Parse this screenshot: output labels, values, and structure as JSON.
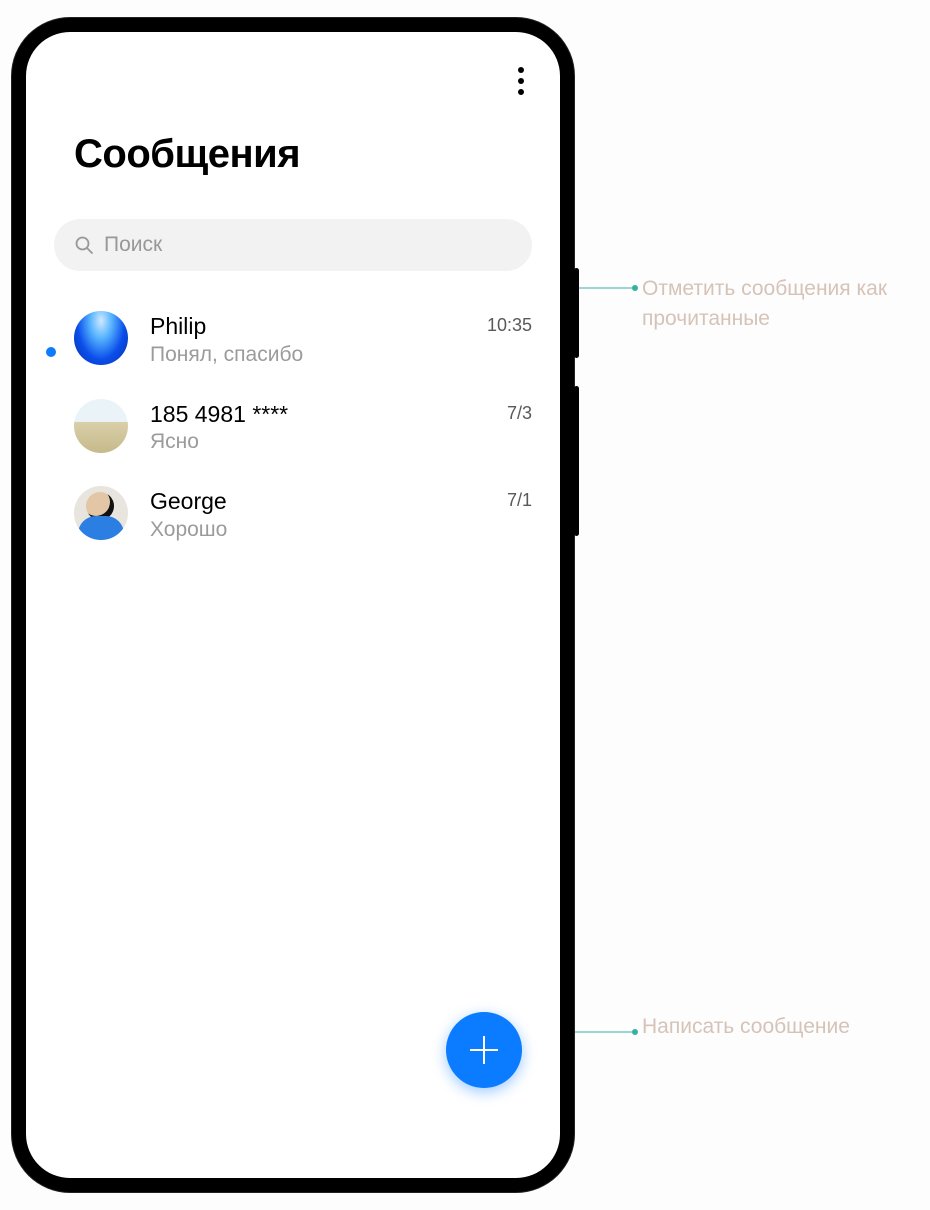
{
  "header": {
    "title": "Сообщения"
  },
  "search": {
    "placeholder": "Поиск"
  },
  "conversations": [
    {
      "name": "Philip",
      "preview": "Понял, спасибо",
      "time": "10:35",
      "unread": true,
      "avatar": "ocean"
    },
    {
      "name": "185 4981 ****",
      "preview": "Ясно",
      "time": "7/3",
      "unread": false,
      "avatar": "beach"
    },
    {
      "name": "George",
      "preview": "Хорошо",
      "time": "7/1",
      "unread": false,
      "avatar": "person"
    }
  ],
  "annotations": {
    "mark_read": "Отметить сообщения как прочитанные",
    "compose": "Написать сообщение"
  },
  "colors": {
    "accent": "#0b7cff",
    "connector": "#35b1a4",
    "annotation_text": "#d6c3b8"
  }
}
